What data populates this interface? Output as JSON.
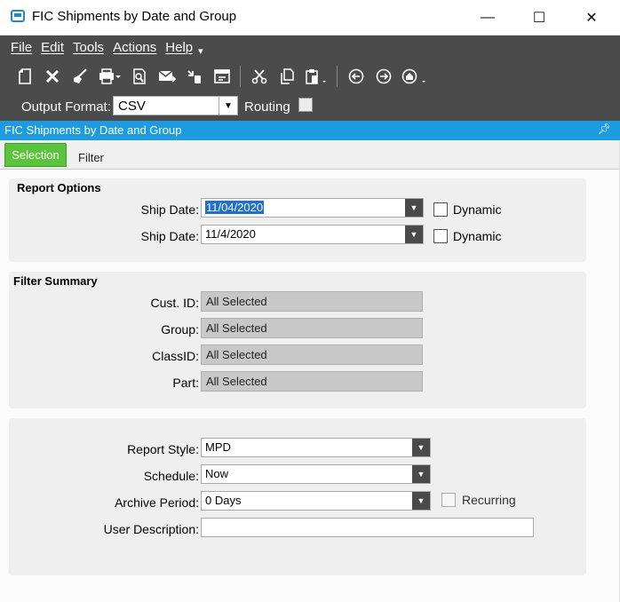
{
  "window": {
    "title": "FIC Shipments by Date and Group"
  },
  "menu": {
    "items": [
      "File",
      "Edit",
      "Tools",
      "Actions",
      "Help"
    ]
  },
  "output": {
    "label": "Output Format:",
    "value": "CSV",
    "routing_label": "Routing"
  },
  "panel": {
    "title": "FIC Shipments by Date and Group"
  },
  "tabs": {
    "selection": "Selection",
    "filter": "Filter"
  },
  "report_options": {
    "title": "Report Options",
    "ship_date_label": "Ship Date:",
    "ship_date_1": "11/04/2020",
    "ship_date_2": "11/4/2020",
    "dynamic_label": "Dynamic"
  },
  "filter_summary": {
    "title": "Filter Summary",
    "rows": [
      {
        "label": "Cust. ID:",
        "value": "All Selected"
      },
      {
        "label": "Group:",
        "value": "All Selected"
      },
      {
        "label": "ClassID:",
        "value": "All Selected"
      },
      {
        "label": "Part:",
        "value": "All Selected"
      }
    ]
  },
  "schedule": {
    "report_style_label": "Report Style:",
    "report_style": "MPD",
    "schedule_label": "Schedule:",
    "schedule": "Now",
    "archive_label": "Archive Period:",
    "archive": "0 Days",
    "recurring_label": "Recurring",
    "user_desc_label": "User Description:",
    "user_desc": ""
  }
}
